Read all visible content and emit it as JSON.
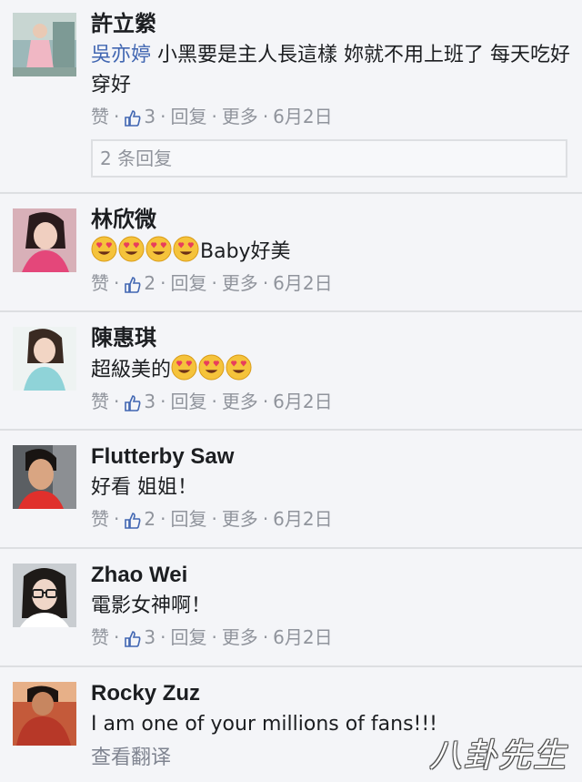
{
  "comments": [
    {
      "name": "許立縈",
      "mention": "吳亦婷",
      "text": " 小黑要是主人長這樣 妳就不用上班了 每天吃好穿好",
      "meta": {
        "like": "赞",
        "likes": "3",
        "reply": "回复",
        "more": "更多",
        "date": "6月2日"
      },
      "replies": "2 条回复"
    },
    {
      "name": "林欣微",
      "text": "Baby好美",
      "emoji_count": 4,
      "meta": {
        "like": "赞",
        "likes": "2",
        "reply": "回复",
        "more": "更多",
        "date": "6月2日"
      }
    },
    {
      "name": "陳惠琪",
      "text": "超級美的",
      "emoji_count": 3,
      "meta": {
        "like": "赞",
        "likes": "3",
        "reply": "回复",
        "more": "更多",
        "date": "6月2日"
      }
    },
    {
      "name": "Flutterby Saw",
      "text": "好看 姐姐！",
      "meta": {
        "like": "赞",
        "likes": "2",
        "reply": "回复",
        "more": "更多",
        "date": "6月2日"
      }
    },
    {
      "name": "Zhao Wei",
      "text": "電影女神啊！",
      "meta": {
        "like": "赞",
        "likes": "3",
        "reply": "回复",
        "more": "更多",
        "date": "6月2日"
      }
    },
    {
      "name": "Rocky Zuz",
      "text": "I am one of your millions of fans!!!",
      "translate": "查看翻译"
    }
  ],
  "watermark": "八卦先生",
  "colors": {
    "link": "#4267b2",
    "meta": "#90949c",
    "text": "#1c1e21",
    "divider": "#dddfe2",
    "background": "#f4f5f8"
  }
}
